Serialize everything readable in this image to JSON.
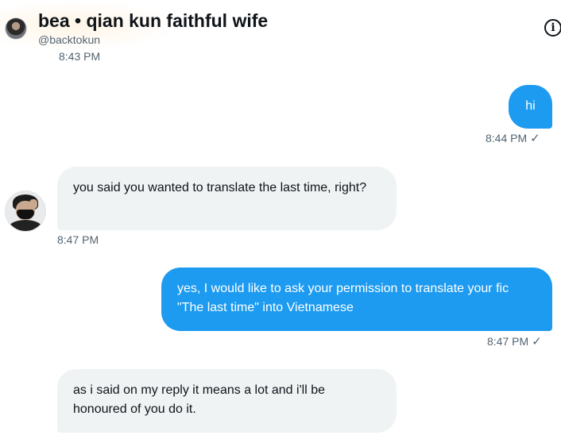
{
  "header": {
    "title": "bea • qian kun faithful wife",
    "handle": "@backtokun",
    "info_icon": "info-icon"
  },
  "messages": [
    {
      "id": "m0",
      "direction": "incoming",
      "time": "8:43 PM"
    },
    {
      "id": "m1",
      "direction": "outgoing",
      "text": "hi",
      "time": "8:44 PM",
      "status_icon": "sent-check-icon"
    },
    {
      "id": "m2",
      "direction": "incoming",
      "text": "you said you wanted to translate the last time, right?",
      "time": "8:47 PM"
    },
    {
      "id": "m3",
      "direction": "outgoing",
      "text": "yes, I would like to ask your permission to translate your fic \"The last time\" into Vietnamese",
      "time": "8:47 PM",
      "status_icon": "sent-check-icon"
    },
    {
      "id": "m4",
      "direction": "incoming",
      "text": "as i said on my reply it means a lot and i'll be honoured of you do it."
    }
  ],
  "colors": {
    "outgoing_bubble": "#1d9bf0",
    "incoming_bubble": "#eff3f4",
    "timestamp": "#536471",
    "text": "#0f1419"
  }
}
